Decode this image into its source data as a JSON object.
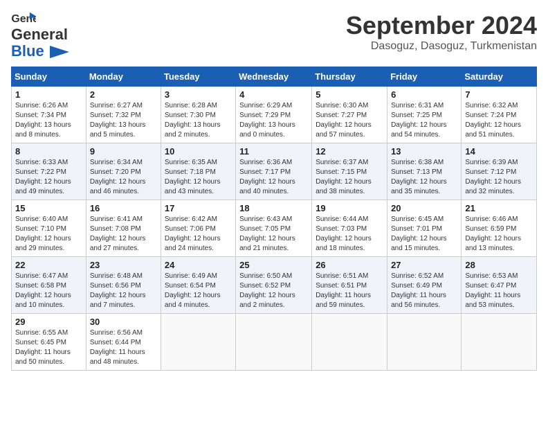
{
  "header": {
    "logo_general": "General",
    "logo_blue": "Blue",
    "month": "September 2024",
    "location": "Dasoguz, Dasoguz, Turkmenistan"
  },
  "weekdays": [
    "Sunday",
    "Monday",
    "Tuesday",
    "Wednesday",
    "Thursday",
    "Friday",
    "Saturday"
  ],
  "weeks": [
    [
      {
        "day": "1",
        "sunrise": "6:26 AM",
        "sunset": "7:34 PM",
        "daylight": "13 hours and 8 minutes."
      },
      {
        "day": "2",
        "sunrise": "6:27 AM",
        "sunset": "7:32 PM",
        "daylight": "13 hours and 5 minutes."
      },
      {
        "day": "3",
        "sunrise": "6:28 AM",
        "sunset": "7:30 PM",
        "daylight": "13 hours and 2 minutes."
      },
      {
        "day": "4",
        "sunrise": "6:29 AM",
        "sunset": "7:29 PM",
        "daylight": "13 hours and 0 minutes."
      },
      {
        "day": "5",
        "sunrise": "6:30 AM",
        "sunset": "7:27 PM",
        "daylight": "12 hours and 57 minutes."
      },
      {
        "day": "6",
        "sunrise": "6:31 AM",
        "sunset": "7:25 PM",
        "daylight": "12 hours and 54 minutes."
      },
      {
        "day": "7",
        "sunrise": "6:32 AM",
        "sunset": "7:24 PM",
        "daylight": "12 hours and 51 minutes."
      }
    ],
    [
      {
        "day": "8",
        "sunrise": "6:33 AM",
        "sunset": "7:22 PM",
        "daylight": "12 hours and 49 minutes."
      },
      {
        "day": "9",
        "sunrise": "6:34 AM",
        "sunset": "7:20 PM",
        "daylight": "12 hours and 46 minutes."
      },
      {
        "day": "10",
        "sunrise": "6:35 AM",
        "sunset": "7:18 PM",
        "daylight": "12 hours and 43 minutes."
      },
      {
        "day": "11",
        "sunrise": "6:36 AM",
        "sunset": "7:17 PM",
        "daylight": "12 hours and 40 minutes."
      },
      {
        "day": "12",
        "sunrise": "6:37 AM",
        "sunset": "7:15 PM",
        "daylight": "12 hours and 38 minutes."
      },
      {
        "day": "13",
        "sunrise": "6:38 AM",
        "sunset": "7:13 PM",
        "daylight": "12 hours and 35 minutes."
      },
      {
        "day": "14",
        "sunrise": "6:39 AM",
        "sunset": "7:12 PM",
        "daylight": "12 hours and 32 minutes."
      }
    ],
    [
      {
        "day": "15",
        "sunrise": "6:40 AM",
        "sunset": "7:10 PM",
        "daylight": "12 hours and 29 minutes."
      },
      {
        "day": "16",
        "sunrise": "6:41 AM",
        "sunset": "7:08 PM",
        "daylight": "12 hours and 27 minutes."
      },
      {
        "day": "17",
        "sunrise": "6:42 AM",
        "sunset": "7:06 PM",
        "daylight": "12 hours and 24 minutes."
      },
      {
        "day": "18",
        "sunrise": "6:43 AM",
        "sunset": "7:05 PM",
        "daylight": "12 hours and 21 minutes."
      },
      {
        "day": "19",
        "sunrise": "6:44 AM",
        "sunset": "7:03 PM",
        "daylight": "12 hours and 18 minutes."
      },
      {
        "day": "20",
        "sunrise": "6:45 AM",
        "sunset": "7:01 PM",
        "daylight": "12 hours and 15 minutes."
      },
      {
        "day": "21",
        "sunrise": "6:46 AM",
        "sunset": "6:59 PM",
        "daylight": "12 hours and 13 minutes."
      }
    ],
    [
      {
        "day": "22",
        "sunrise": "6:47 AM",
        "sunset": "6:58 PM",
        "daylight": "12 hours and 10 minutes."
      },
      {
        "day": "23",
        "sunrise": "6:48 AM",
        "sunset": "6:56 PM",
        "daylight": "12 hours and 7 minutes."
      },
      {
        "day": "24",
        "sunrise": "6:49 AM",
        "sunset": "6:54 PM",
        "daylight": "12 hours and 4 minutes."
      },
      {
        "day": "25",
        "sunrise": "6:50 AM",
        "sunset": "6:52 PM",
        "daylight": "12 hours and 2 minutes."
      },
      {
        "day": "26",
        "sunrise": "6:51 AM",
        "sunset": "6:51 PM",
        "daylight": "11 hours and 59 minutes."
      },
      {
        "day": "27",
        "sunrise": "6:52 AM",
        "sunset": "6:49 PM",
        "daylight": "11 hours and 56 minutes."
      },
      {
        "day": "28",
        "sunrise": "6:53 AM",
        "sunset": "6:47 PM",
        "daylight": "11 hours and 53 minutes."
      }
    ],
    [
      {
        "day": "29",
        "sunrise": "6:55 AM",
        "sunset": "6:45 PM",
        "daylight": "11 hours and 50 minutes."
      },
      {
        "day": "30",
        "sunrise": "6:56 AM",
        "sunset": "6:44 PM",
        "daylight": "11 hours and 48 minutes."
      },
      null,
      null,
      null,
      null,
      null
    ]
  ]
}
